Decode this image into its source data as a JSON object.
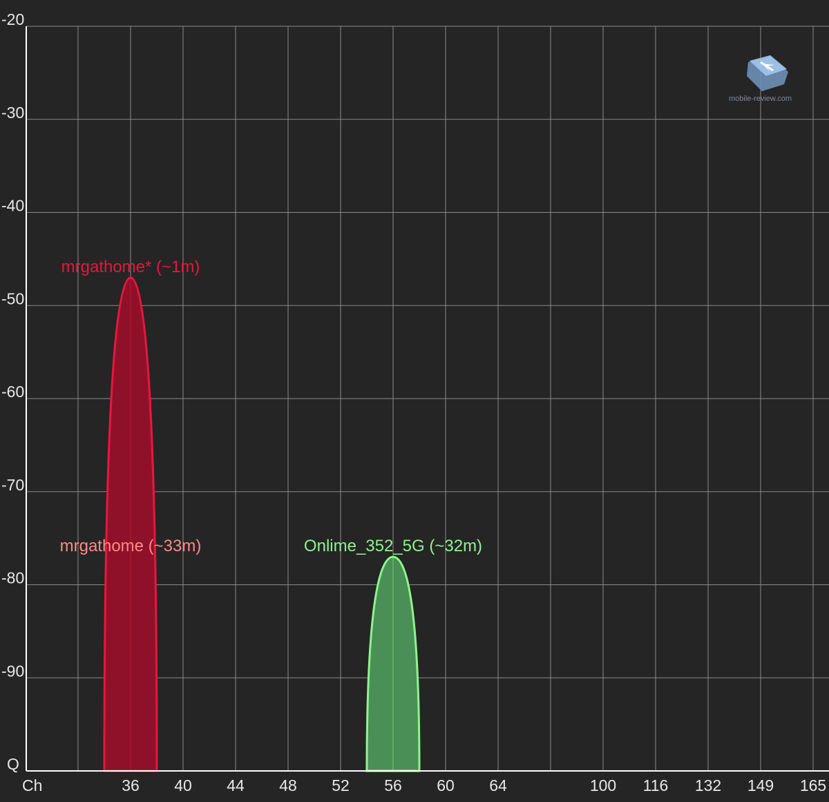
{
  "chart_data": {
    "type": "area",
    "y_axis": {
      "min": -100,
      "max": -20,
      "ticks": [
        -20,
        -30,
        -40,
        -50,
        -60,
        -70,
        -80,
        -90
      ],
      "baseline_label": "Q"
    },
    "x_axis": {
      "label": "Ch",
      "ticks": [
        "36",
        "40",
        "44",
        "48",
        "52",
        "56",
        "60",
        "64",
        "100",
        "116",
        "132",
        "149",
        "165"
      ]
    },
    "grid": true,
    "series": [
      {
        "name": "mrgathome* (~1m)",
        "channel": "36",
        "peak_dbm": -47,
        "channel_span": 4,
        "color": "#e8163f",
        "fill": "#8f1129"
      },
      {
        "name": "mrgathome (~33m)",
        "channel": "36",
        "peak_dbm": -77,
        "channel_span": 4,
        "color": "#ff8a88",
        "fill": "#cd4b55"
      },
      {
        "name": "Onlime_352_5G (~32m)",
        "channel": "56",
        "peak_dbm": -77,
        "channel_span": 4,
        "color": "#8ef58e",
        "fill": "#4a8f55"
      }
    ]
  },
  "watermark": {
    "text": "mobile-review.com",
    "icon": "mobile-review-logo-icon"
  }
}
